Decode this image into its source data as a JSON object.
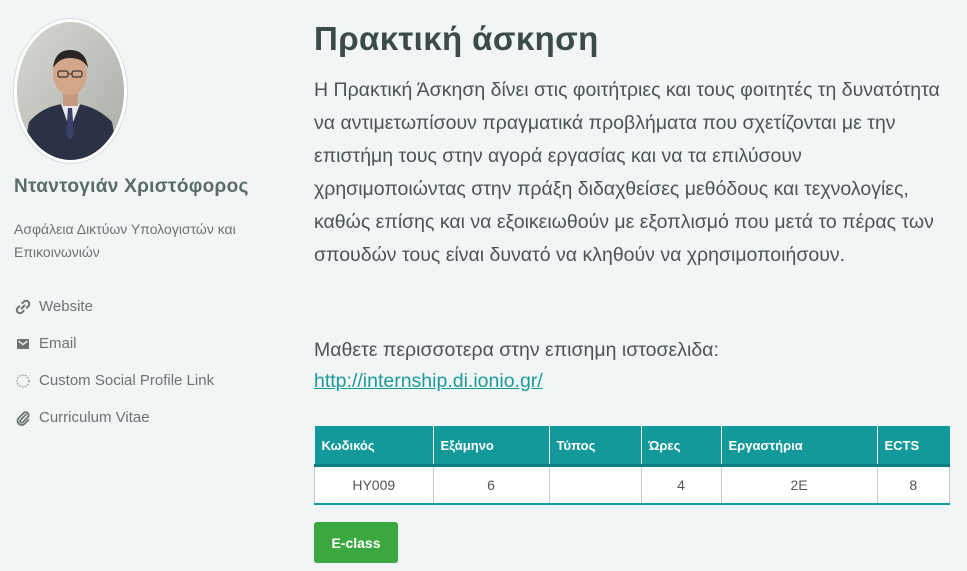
{
  "profile": {
    "name": "Νταντογιάν Χριστόφορος",
    "subtitle": "Ασφάλεια Δικτύων Υπολογιστών και Επικοινωνιών",
    "links": [
      {
        "label": "Website",
        "icon": "link-icon"
      },
      {
        "label": "Email",
        "icon": "envelope-icon"
      },
      {
        "label": "Custom Social Profile Link",
        "icon": "dashed-circle-icon"
      },
      {
        "label": "Curriculum Vitae",
        "icon": "paperclip-icon"
      }
    ]
  },
  "content": {
    "title": "Πρακτική άσκηση",
    "description": "Η Πρακτική Άσκηση δίνει στις φοιτήτριες και τους φοιτητές τη δυνατότητα να αντιμετωπίσουν πραγματικά προβλήματα που σχετίζονται με την επιστήμη τους στην αγορά εργασίας και να τα επιλύσουν χρησιμοποιώντας στην πράξη διδαχθείσες μεθόδους και τεχνολογίες, καθώς επίσης και να εξοικειωθούν με εξοπλισμό που μετά το πέρας των σπουδών τους είναι δυνατό να κληθούν να χρησιμοποιήσουν.",
    "learn_more_text": "Μαθετε περισσοτερα στην επισημη ιστοσελιδα:",
    "learn_more_link": "http://internship.di.ionio.gr/"
  },
  "table": {
    "headers": [
      "Κωδικός",
      "Εξάμηνο",
      "Τύπος",
      "Ώρες",
      "Εργαστήρια",
      "ECTS"
    ],
    "rows": [
      [
        "HY009",
        "6",
        "",
        "4",
        "2E",
        "8"
      ]
    ]
  },
  "actions": {
    "eclass_label": "E-class"
  },
  "colors": {
    "accent": "#13999a",
    "button": "#3aa83f",
    "background": "#f1f5f6"
  }
}
